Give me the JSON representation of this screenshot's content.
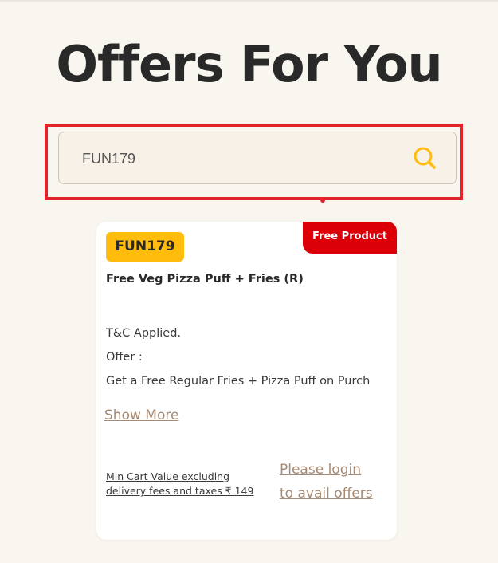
{
  "page": {
    "title": "Offers For You"
  },
  "search": {
    "value": "FUN179",
    "placeholder": ""
  },
  "offer": {
    "tag": "Free Product",
    "code": "FUN179",
    "title": "Free Veg Pizza Puff + Fries (R)",
    "description": [
      "T&C Applied.",
      "Offer :",
      "Get a Free Regular Fries + Pizza Puff on Purch"
    ],
    "show_more": "Show More",
    "min_cart": {
      "line1": "Min Cart Value excluding",
      "line2": "delivery fees and taxes ₹ 149"
    },
    "login": {
      "line1": "Please login",
      "line2": "to avail offers"
    }
  },
  "colors": {
    "background": "#f9f5ef",
    "accent_yellow": "#ffbc0d",
    "tag_red": "#db0007",
    "highlight_red": "#e3242b",
    "link_brown": "#a68a73"
  },
  "icons": {
    "search": "search-icon"
  }
}
